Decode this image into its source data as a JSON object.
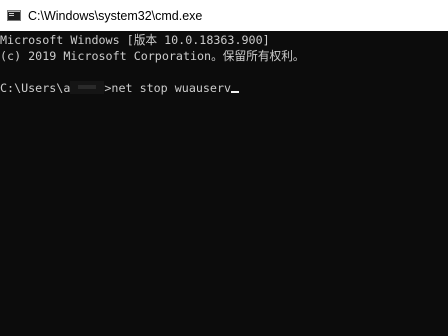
{
  "window": {
    "title": "C:\\Windows\\system32\\cmd.exe",
    "icon": "cmd-console-icon"
  },
  "console": {
    "banner_line_1": "Microsoft Windows [版本 10.0.18363.900]",
    "banner_line_2": "(c) 2019 Microsoft Corporation。保留所有权利。",
    "prompt_prefix": "C:\\Users\\a",
    "prompt_suffix": ">",
    "command": "net stop wuauserv",
    "text_color": "#cccccc",
    "background_color": "#0c0c0c"
  }
}
